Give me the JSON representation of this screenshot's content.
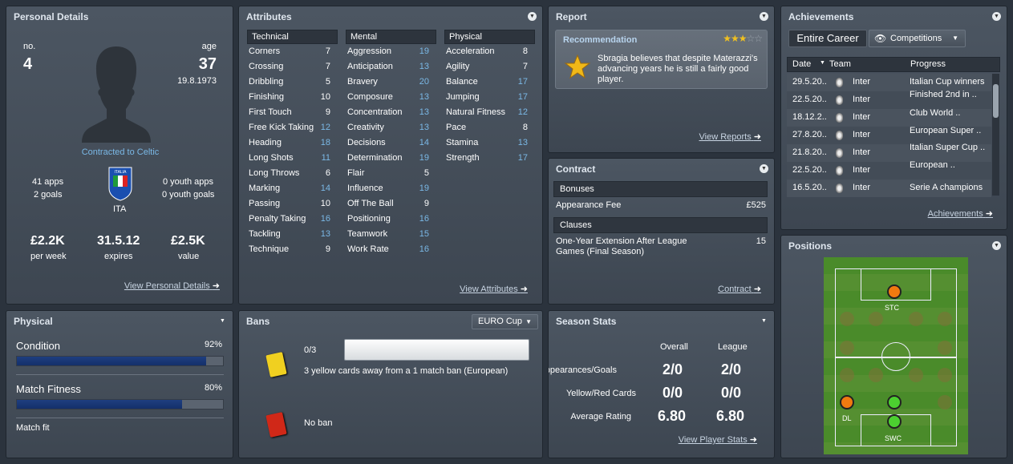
{
  "personal": {
    "title": "Personal Details",
    "no_label": "no.",
    "no": "4",
    "age_label": "age",
    "age": "37",
    "dob": "19.8.1973",
    "contract": "Contracted to Celtic",
    "apps": "41 apps",
    "goals": "2 goals",
    "youth_apps": "0 youth apps",
    "youth_goals": "0 youth goals",
    "nation": "ITA",
    "wage": "£2.2K",
    "wage_label": "per week",
    "expires": "31.5.12",
    "expires_label": "expires",
    "value": "£2.5K",
    "value_label": "value",
    "link": "View Personal Details"
  },
  "attributes": {
    "title": "Attributes",
    "link": "View Attributes",
    "technical": {
      "header": "Technical",
      "rows": [
        [
          "Corners",
          "7"
        ],
        [
          "Crossing",
          "7"
        ],
        [
          "Dribbling",
          "5"
        ],
        [
          "Finishing",
          "10"
        ],
        [
          "First Touch",
          "9"
        ],
        [
          "Free Kick Taking",
          "12"
        ],
        [
          "Heading",
          "18"
        ],
        [
          "Long Shots",
          "11"
        ],
        [
          "Long Throws",
          "6"
        ],
        [
          "Marking",
          "14"
        ],
        [
          "Passing",
          "10"
        ],
        [
          "Penalty Taking",
          "16"
        ],
        [
          "Tackling",
          "13"
        ],
        [
          "Technique",
          "9"
        ]
      ]
    },
    "mental": {
      "header": "Mental",
      "rows": [
        [
          "Aggression",
          "19"
        ],
        [
          "Anticipation",
          "13"
        ],
        [
          "Bravery",
          "20"
        ],
        [
          "Composure",
          "13"
        ],
        [
          "Concentration",
          "13"
        ],
        [
          "Creativity",
          "13"
        ],
        [
          "Decisions",
          "14"
        ],
        [
          "Determination",
          "19"
        ],
        [
          "Flair",
          "5"
        ],
        [
          "Influence",
          "19"
        ],
        [
          "Off The Ball",
          "9"
        ],
        [
          "Positioning",
          "16"
        ],
        [
          "Teamwork",
          "15"
        ],
        [
          "Work Rate",
          "16"
        ]
      ]
    },
    "physical": {
      "header": "Physical",
      "rows": [
        [
          "Acceleration",
          "8"
        ],
        [
          "Agility",
          "7"
        ],
        [
          "Balance",
          "17"
        ],
        [
          "Jumping",
          "17"
        ],
        [
          "Natural Fitness",
          "12"
        ],
        [
          "Pace",
          "8"
        ],
        [
          "Stamina",
          "13"
        ],
        [
          "Strength",
          "17"
        ]
      ]
    }
  },
  "report": {
    "title": "Report",
    "rec_title": "Recommendation",
    "rating": 2.5,
    "text": "Sbragia believes that despite Materazzi's advancing years he is still a fairly good player.",
    "link": "View Reports"
  },
  "contract": {
    "title": "Contract",
    "bonuses": "Bonuses",
    "fee_label": "Appearance Fee",
    "fee": "£525",
    "clauses": "Clauses",
    "clause_text": "One-Year Extension After League Games (Final Season)",
    "clause_value": "15",
    "link": "Contract"
  },
  "achievements": {
    "title": "Achievements",
    "tab": "Entire Career",
    "comp": "Competitions",
    "col_date": "Date",
    "col_team": "Team",
    "col_progress": "Progress",
    "rows": [
      [
        "29.5.20..",
        "Inter",
        "Italian Cup winners"
      ],
      [
        "22.5.20..",
        "Inter",
        "Finished 2nd in .."
      ],
      [
        "18.12.2..",
        "Inter",
        "Club World .."
      ],
      [
        "27.8.20..",
        "Inter",
        "European Super .."
      ],
      [
        "21.8.20..",
        "Inter",
        "Italian Super Cup .."
      ],
      [
        "22.5.20..",
        "Inter",
        "European .."
      ],
      [
        "16.5.20..",
        "Inter",
        "Serie A champions"
      ]
    ],
    "link": "Achievements"
  },
  "positions": {
    "title": "Positions",
    "labels": [
      "STC",
      "DL",
      "SWC"
    ]
  },
  "physical": {
    "title": "Physical",
    "condition_label": "Condition",
    "condition": "92%",
    "condition_value": 0.92,
    "fitness_label": "Match Fitness",
    "fitness": "80%",
    "fitness_value": 0.8,
    "status": "Match fit"
  },
  "bans": {
    "title": "Bans",
    "select": "EURO Cup",
    "yellow": "0/3",
    "yellow_progress": 0,
    "yellow_text": "3 yellow cards away from a 1 match ban (European)",
    "red_text": "No ban"
  },
  "season": {
    "title": "Season Stats",
    "col_overall": "Overall",
    "col_league": "League",
    "rows": [
      [
        "Appearances/Goals",
        "2/0",
        "2/0"
      ],
      [
        "Yellow/Red Cards",
        "0/0",
        "0/0"
      ],
      [
        "Average Rating",
        "6.80",
        "6.80"
      ]
    ],
    "link": "View Player Stats"
  },
  "colors": {
    "accent": "#7ab8e6",
    "natural": "#f07a10",
    "accomplished": "#4cd030"
  }
}
